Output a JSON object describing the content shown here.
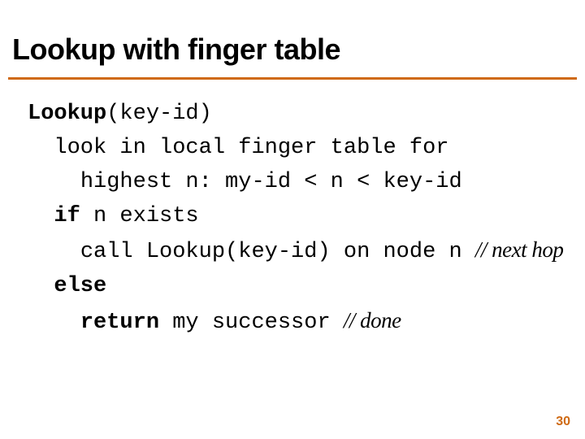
{
  "title": "Lookup with finger table",
  "code": {
    "fn": "Lookup",
    "args": "(key-id)",
    "l1": "look in local finger table for",
    "l2": "highest n: my-id < n < key-id",
    "if": "if",
    "l3": " n exists",
    "l4": "call Lookup(key-id) on node n ",
    "c1": "// next hop",
    "else": "else",
    "return": "return",
    "l5": " my successor ",
    "c2": "// done"
  },
  "pagenum": "30"
}
